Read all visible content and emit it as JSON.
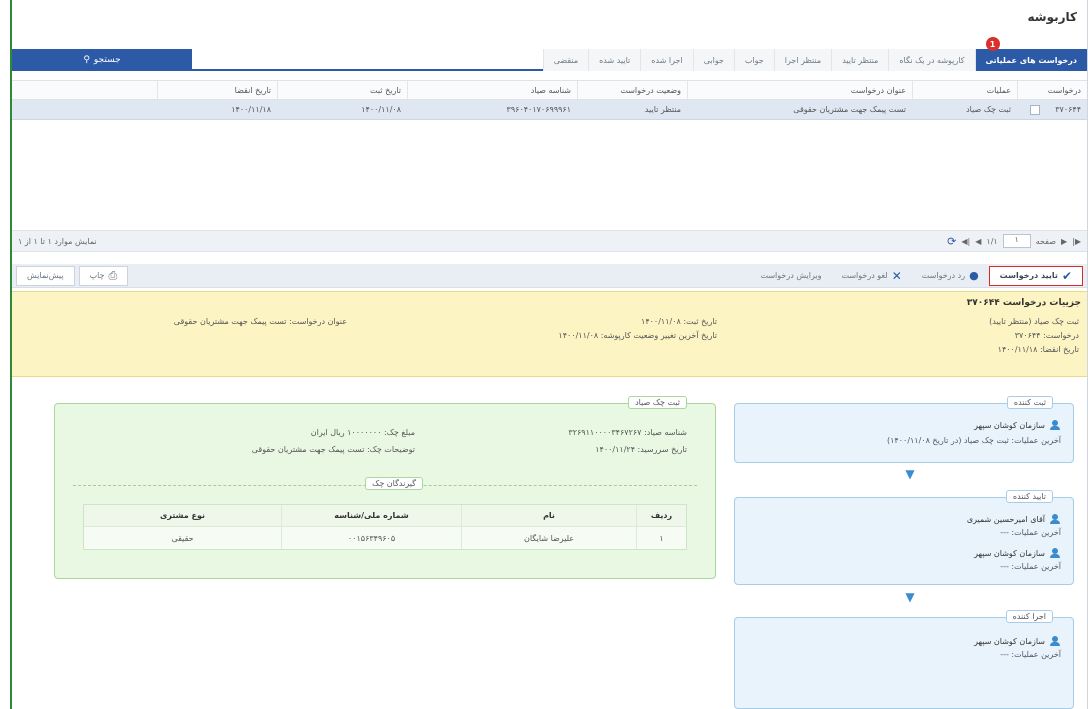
{
  "window": {
    "title": "کاربوشه"
  },
  "tabs": [
    {
      "label": "درخواست های عملیاتی",
      "badge": "1",
      "active": true
    },
    {
      "label": "کارپوشه در یک نگاه"
    },
    {
      "label": "منتظر تایید"
    },
    {
      "label": "منتظر اجرا"
    },
    {
      "label": "جواب"
    },
    {
      "label": "جوابی"
    },
    {
      "label": "اجرا شده"
    },
    {
      "label": "تایید شده"
    },
    {
      "label": "منقضی"
    }
  ],
  "search": {
    "label": "جستجو"
  },
  "grid": {
    "columns": [
      "درخواست",
      "عملیات",
      "عنوان درخواست",
      "وضعیت درخواست",
      "شناسه صیاد",
      "تاریخ ثبت",
      "تاریخ انقضا"
    ],
    "rows": [
      {
        "request": "۳۷۰۶۴۴",
        "operation": "ثبت چک صیاد",
        "subject": "تست پیمک جهت مشتریان حقوقی",
        "status": "منتظر تایید",
        "sayad_id": "۳۹۶۰۴۰۱۷۰۶۹۹۹۶۱",
        "reg_date": "۱۴۰۰/۱۱/۰۸",
        "exp_date": "۱۴۰۰/۱۱/۱۸"
      }
    ]
  },
  "pager": {
    "page_label": "صفحه",
    "page_value": "۱",
    "of": "۱/۱",
    "count": "نمایش موارد ۱ تا ۱ از ۱"
  },
  "toolbar": {
    "confirm": "تایید درخواست",
    "reject": "رد درخواست",
    "cancel": "لغو درخواست",
    "edit": "ویرایش درخواست",
    "print": "چاپ",
    "help": "پیش‌نمایش"
  },
  "details": {
    "title": "جزییات درخواست ۳۷۰۶۴۴",
    "op": "ثبت چک صیاد (منتظر تایید)",
    "req": "درخواست: ۳۷۰۶۴۴",
    "expire": "تاریخ انقضا: ۱۴۰۰/۱۱/۱۸",
    "reg": "تاریخ ثبت: ۱۴۰۰/۱۱/۰۸",
    "last_change": "تاریخ آخرین تغییر وضعیت کارپوشه: ۱۴۰۰/۱۱/۰۸",
    "subject": "عنوان درخواست: تست پیمک جهت مشتریان حقوقی"
  },
  "workflow": [
    {
      "caption": "ثبت کننده",
      "name": "سازمان کوشان سپهر",
      "action": "آخرین عملیات: ثبت چک صیاد (در تاریخ ۱۴۰۰/۱۱/۰۸)"
    },
    {
      "caption": "تایید کننده",
      "name": "آقای امیرحسین شمیری",
      "action": "آخرین عملیات: ---",
      "name2": "سازمان کوشان سپهر",
      "action2": "آخرین عملیات: ---"
    },
    {
      "caption": "اجرا کننده",
      "name": "سازمان کوشان سپهر",
      "action": "آخرین عملیات: ---"
    }
  ],
  "cheque": {
    "caption": "ثبت چک صیاد",
    "sayad": "شناسه صیاد: ۳۲۶۹۱۱۰۰۰۰۳۴۶۷۲۶۷",
    "due": "تاریخ سررسید: ۱۴۰۰/۱۱/۲۴",
    "amount": "مبلغ چک: ۱۰۰۰۰۰۰۰ ریال ایران",
    "desc": "توضیحات چک: تست پیمک جهت مشتریان حقوقی",
    "payees_caption": "گیرندگان چک",
    "table": {
      "headers": [
        "ردیف",
        "نام",
        "شماره ملی/شناسه",
        "نوع مشتری"
      ],
      "rows": [
        {
          "row": "۱",
          "name": "علیرضا شایگان",
          "nid": "۰۰۱۵۶۳۴۹۶۰۵",
          "type": "حقیقی"
        }
      ]
    }
  },
  "colors": {
    "accent": "#2d5aa7",
    "badge": "#d9302a",
    "details_bg": "#fdf4c4",
    "workflow_bg": "#e8f3fc",
    "cheque_bg": "#e9f8e3",
    "highlight_border": "#d52b2b"
  }
}
